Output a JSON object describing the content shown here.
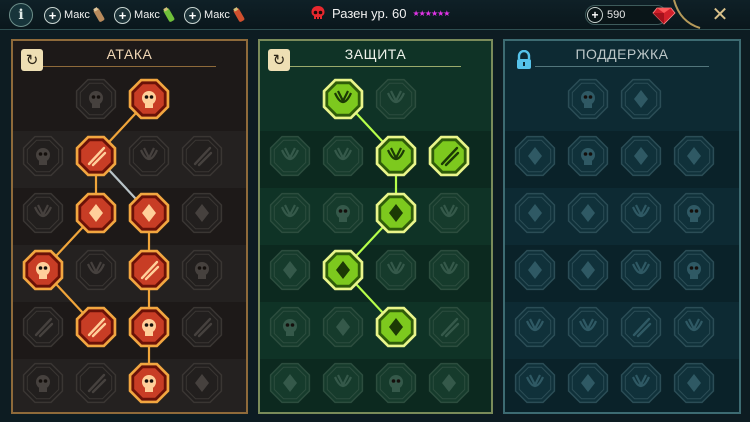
{
  "topbar": {
    "info_label": "i",
    "resources": [
      {
        "plus": "+",
        "label": "Макс",
        "item_icon": "potion-scroll-icon",
        "color": "#b88a5c"
      },
      {
        "plus": "+",
        "label": "Макс",
        "item_icon": "green-potion-icon",
        "color": "#6fbf3a"
      },
      {
        "plus": "+",
        "label": "Макс",
        "item_icon": "red-potion-icon",
        "color": "#d0502e"
      }
    ],
    "champion": {
      "skull_icon": "red-skull-icon",
      "name": "Разен ур. 60",
      "stars": "★★★★★★"
    },
    "gems": {
      "plus": "+",
      "value": "590",
      "icon": "red-gem-icon"
    },
    "close_label": "✕"
  },
  "colors": {
    "attack": "#e8502c",
    "attack_glow": "#f0a53a",
    "defense": "#8fe02a",
    "defense_glow": "#b6ff4a",
    "support": "#5fc3e8"
  },
  "panels": [
    {
      "key": "attack",
      "title": "АТАКА",
      "head_icon": "reset-icon",
      "head_glyph": "↻",
      "nodes": [
        {
          "r": 0,
          "c": 1,
          "state": "locked",
          "icon": "crossed-swords-icon"
        },
        {
          "r": 0,
          "c": 2,
          "state": "active",
          "icon": "claw-slash-icon"
        },
        {
          "r": 1,
          "c": 0,
          "state": "locked",
          "icon": "demon-mask-icon"
        },
        {
          "r": 1,
          "c": 1,
          "state": "active",
          "icon": "sword-slash-icon"
        },
        {
          "r": 1,
          "c": 2,
          "state": "locked",
          "icon": "shield-break-icon"
        },
        {
          "r": 1,
          "c": 3,
          "state": "locked",
          "icon": "horned-head-icon"
        },
        {
          "r": 2,
          "c": 0,
          "state": "locked",
          "icon": "windmill-icon"
        },
        {
          "r": 2,
          "c": 1,
          "state": "active",
          "icon": "fangs-icon"
        },
        {
          "r": 2,
          "c": 2,
          "state": "active",
          "icon": "skull-cut-icon"
        },
        {
          "r": 2,
          "c": 3,
          "state": "locked",
          "icon": "blade-icon"
        },
        {
          "r": 3,
          "c": 0,
          "state": "active",
          "icon": "bleeding-blade-icon"
        },
        {
          "r": 3,
          "c": 1,
          "state": "locked",
          "icon": "fist-icon"
        },
        {
          "r": 3,
          "c": 2,
          "state": "active",
          "icon": "axe-icon"
        },
        {
          "r": 3,
          "c": 3,
          "state": "locked",
          "icon": "beast-claw-icon"
        },
        {
          "r": 4,
          "c": 0,
          "state": "locked",
          "icon": "winged-helm-icon"
        },
        {
          "r": 4,
          "c": 1,
          "state": "active",
          "icon": "twin-skulls-icon"
        },
        {
          "r": 4,
          "c": 2,
          "state": "active",
          "icon": "spinning-blade-icon"
        },
        {
          "r": 4,
          "c": 3,
          "state": "locked",
          "icon": "warrior-icon"
        },
        {
          "r": 5,
          "c": 0,
          "state": "locked",
          "icon": "crossed-blades-icon"
        },
        {
          "r": 5,
          "c": 1,
          "state": "locked",
          "icon": "knight-helm-icon"
        },
        {
          "r": 5,
          "c": 2,
          "state": "active",
          "icon": "demon-lord-icon"
        },
        {
          "r": 5,
          "c": 3,
          "state": "locked",
          "icon": "skull-icon"
        }
      ],
      "links": [
        [
          0,
          2,
          1,
          1
        ],
        [
          1,
          1,
          2,
          1
        ],
        [
          1,
          1,
          2,
          2
        ],
        [
          2,
          1,
          3,
          0
        ],
        [
          2,
          2,
          3,
          2
        ],
        [
          3,
          0,
          4,
          1
        ],
        [
          3,
          2,
          4,
          2
        ],
        [
          4,
          2,
          5,
          2
        ]
      ]
    },
    {
      "key": "defense",
      "title": "ЗАЩИТА",
      "head_icon": "reset-icon",
      "head_glyph": "↻",
      "nodes": [
        {
          "r": 0,
          "c": 1,
          "state": "active",
          "icon": "wall-icon"
        },
        {
          "r": 0,
          "c": 2,
          "state": "locked",
          "icon": "fist-icon"
        },
        {
          "r": 1,
          "c": 0,
          "state": "locked",
          "icon": "robed-figure-icon"
        },
        {
          "r": 1,
          "c": 1,
          "state": "locked",
          "icon": "flame-shield-icon"
        },
        {
          "r": 1,
          "c": 2,
          "state": "active",
          "icon": "armored-body-icon"
        },
        {
          "r": 1,
          "c": 3,
          "state": "active",
          "icon": "crossed-daggers-icon"
        },
        {
          "r": 2,
          "c": 0,
          "state": "locked",
          "icon": "bird-icon"
        },
        {
          "r": 2,
          "c": 1,
          "state": "locked",
          "icon": "shield-icon"
        },
        {
          "r": 2,
          "c": 2,
          "state": "active",
          "icon": "heart-icon"
        },
        {
          "r": 2,
          "c": 3,
          "state": "locked",
          "icon": "helm-icon"
        },
        {
          "r": 3,
          "c": 0,
          "state": "locked",
          "icon": "guard-icon"
        },
        {
          "r": 3,
          "c": 1,
          "state": "active",
          "icon": "hourglass-icon"
        },
        {
          "r": 3,
          "c": 2,
          "state": "locked",
          "icon": "palm-icon"
        },
        {
          "r": 3,
          "c": 3,
          "state": "locked",
          "icon": "bull-icon"
        },
        {
          "r": 4,
          "c": 0,
          "state": "locked",
          "icon": "sprint-icon"
        },
        {
          "r": 4,
          "c": 1,
          "state": "locked",
          "icon": "drops-icon"
        },
        {
          "r": 4,
          "c": 2,
          "state": "active",
          "icon": "radiant-skull-icon"
        },
        {
          "r": 4,
          "c": 3,
          "state": "locked",
          "icon": "feather-icon"
        },
        {
          "r": 5,
          "c": 0,
          "state": "locked",
          "icon": "beast-icon"
        },
        {
          "r": 5,
          "c": 1,
          "state": "locked",
          "icon": "heart-broken-icon"
        },
        {
          "r": 5,
          "c": 2,
          "state": "locked",
          "icon": "shadow-icon"
        },
        {
          "r": 5,
          "c": 3,
          "state": "locked",
          "icon": "titan-icon"
        }
      ],
      "links": [
        [
          0,
          1,
          1,
          2
        ],
        [
          1,
          2,
          2,
          2
        ],
        [
          2,
          2,
          3,
          1
        ],
        [
          3,
          1,
          4,
          2
        ]
      ]
    },
    {
      "key": "support",
      "title": "ПОДДЕРЖКА",
      "head_icon": "lock-icon",
      "head_glyph": "🔒",
      "nodes": [
        {
          "r": 0,
          "c": 1,
          "state": "locked",
          "icon": "heart-hand-icon"
        },
        {
          "r": 0,
          "c": 2,
          "state": "locked",
          "icon": "swirl-icon"
        },
        {
          "r": 1,
          "c": 0,
          "state": "locked",
          "icon": "praying-hands-icon"
        },
        {
          "r": 1,
          "c": 1,
          "state": "locked",
          "icon": "shield-icon"
        },
        {
          "r": 1,
          "c": 2,
          "state": "locked",
          "icon": "flame-icon"
        },
        {
          "r": 1,
          "c": 3,
          "state": "locked",
          "icon": "speed-icon"
        },
        {
          "r": 2,
          "c": 0,
          "state": "locked",
          "icon": "cheer-icon"
        },
        {
          "r": 2,
          "c": 1,
          "state": "locked",
          "icon": "lightning-icon"
        },
        {
          "r": 2,
          "c": 2,
          "state": "locked",
          "icon": "wave-icon"
        },
        {
          "r": 2,
          "c": 3,
          "state": "locked",
          "icon": "figure-icon"
        },
        {
          "r": 3,
          "c": 0,
          "state": "locked",
          "icon": "heart-icon"
        },
        {
          "r": 3,
          "c": 1,
          "state": "locked",
          "icon": "comet-icon"
        },
        {
          "r": 3,
          "c": 2,
          "state": "locked",
          "icon": "book-icon"
        },
        {
          "r": 3,
          "c": 3,
          "state": "locked",
          "icon": "spikes-icon"
        },
        {
          "r": 4,
          "c": 0,
          "state": "locked",
          "icon": "star-icon"
        },
        {
          "r": 4,
          "c": 1,
          "state": "locked",
          "icon": "rush-icon"
        },
        {
          "r": 4,
          "c": 2,
          "state": "locked",
          "icon": "eye-icon"
        },
        {
          "r": 4,
          "c": 3,
          "state": "locked",
          "icon": "claw-icon"
        },
        {
          "r": 5,
          "c": 0,
          "state": "locked",
          "icon": "bomb-icon"
        },
        {
          "r": 5,
          "c": 1,
          "state": "locked",
          "icon": "skull-icon"
        },
        {
          "r": 5,
          "c": 2,
          "state": "locked",
          "icon": "helm-icon"
        },
        {
          "r": 5,
          "c": 3,
          "state": "locked",
          "icon": "eagle-icon"
        }
      ],
      "links": []
    }
  ]
}
